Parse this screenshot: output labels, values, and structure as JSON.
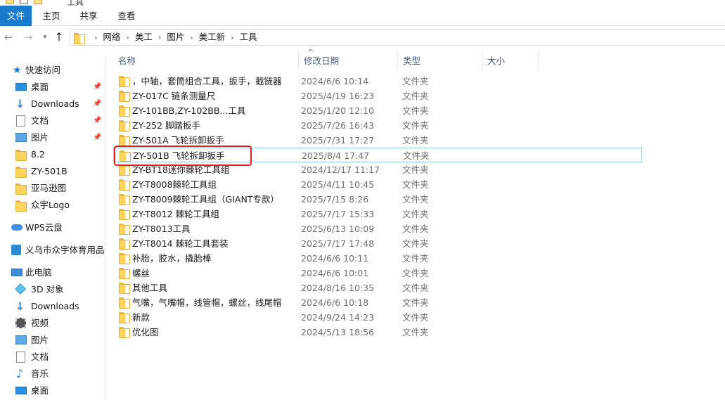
{
  "window": {
    "title": "工具"
  },
  "ribbon": {
    "tabs": [
      "文件",
      "主页",
      "共享",
      "查看"
    ]
  },
  "breadcrumb": [
    "网络",
    "美工",
    "图片",
    "美工新",
    "工具"
  ],
  "nav_pane": {
    "quick_access": "快速访问",
    "pinned": [
      {
        "label": "桌面",
        "icon": "desktop-icon"
      },
      {
        "label": "Downloads",
        "icon": "download-icon"
      },
      {
        "label": "文档",
        "icon": "document-icon"
      },
      {
        "label": "图片",
        "icon": "pictures-icon"
      }
    ],
    "recent": [
      "8.2",
      "ZY-501B",
      "亚马逊图",
      "众宇Logo"
    ],
    "wps": "WPS云盘",
    "company": "义乌市众宇体育用品有限公司",
    "this_pc": "此电脑",
    "pc_items": [
      {
        "label": "3D 对象",
        "icon": "3d-objects-icon"
      },
      {
        "label": "Downloads",
        "icon": "download-icon"
      },
      {
        "label": "视频",
        "icon": "video-icon"
      },
      {
        "label": "图片",
        "icon": "pictures-icon"
      },
      {
        "label": "文档",
        "icon": "document-icon"
      },
      {
        "label": "音乐",
        "icon": "music-icon"
      },
      {
        "label": "桌面",
        "icon": "desktop-icon"
      }
    ]
  },
  "columns": {
    "name": "名称",
    "modified": "修改日期",
    "type": "类型",
    "size": "大小"
  },
  "files": [
    {
      "name": "，中轴，套筒组合工具，扳手，截链器",
      "date": "2024/6/6 10:14",
      "type": "文件夹"
    },
    {
      "name": "ZY-017C  链条测量尺",
      "date": "2025/4/19 16:23",
      "type": "文件夹"
    },
    {
      "name": "ZY-101BB,ZY-102BB...工具",
      "date": "2025/1/20 12:10",
      "type": "文件夹"
    },
    {
      "name": "ZY-252 脚踏扳手",
      "date": "2025/7/26 16:43",
      "type": "文件夹"
    },
    {
      "name": "ZY-501A  飞轮拆卸扳手",
      "date": "2025/7/31 17:27",
      "type": "文件夹"
    },
    {
      "name": "ZY-501B 飞轮拆卸扳手",
      "date": "2025/8/4 17:47",
      "type": "文件夹",
      "selected": true
    },
    {
      "name": "ZY-BT18迷你棘轮工具组",
      "date": "2024/12/17 11:17",
      "type": "文件夹"
    },
    {
      "name": "ZY-T8008棘轮工具组",
      "date": "2025/4/11 10:45",
      "type": "文件夹"
    },
    {
      "name": "ZY-T8009棘轮工具组（GIANT专款）",
      "date": "2025/7/15 8:26",
      "type": "文件夹"
    },
    {
      "name": "ZY-T8012 棘轮工具组",
      "date": "2025/7/17 15:33",
      "type": "文件夹"
    },
    {
      "name": "ZY-T8013工具",
      "date": "2025/6/13 10:09",
      "type": "文件夹"
    },
    {
      "name": "ZY-T8014 棘轮工具套装",
      "date": "2025/7/17 17:48",
      "type": "文件夹"
    },
    {
      "name": "补胎，胶水，撬胎棒",
      "date": "2024/6/6 10:11",
      "type": "文件夹"
    },
    {
      "name": "螺丝",
      "date": "2024/6/6 10:01",
      "type": "文件夹"
    },
    {
      "name": "其他工具",
      "date": "2024/8/16 10:35",
      "type": "文件夹"
    },
    {
      "name": "气嘴，气嘴帽，线管帽，螺丝，线尾帽",
      "date": "2024/6/6 10:18",
      "type": "文件夹"
    },
    {
      "name": "新款",
      "date": "2024/9/24 14:23",
      "type": "文件夹"
    },
    {
      "name": "优化图",
      "date": "2024/5/13 18:56",
      "type": "文件夹"
    }
  ],
  "colors": {
    "accent": "#1979ca",
    "highlight": "#e02020",
    "folder": "#ffd45e"
  }
}
